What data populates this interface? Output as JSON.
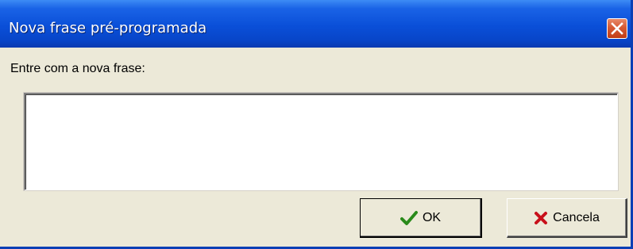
{
  "window": {
    "title": "Nova frase pré-programada",
    "close_icon": "close-icon",
    "colors": {
      "titlebar": "#0a4fd8",
      "body": "#ece9d8",
      "close_button": "#d65a34"
    }
  },
  "form": {
    "prompt_label": "Entre com a nova frase:",
    "phrase_value": ""
  },
  "buttons": {
    "ok": {
      "label": "OK",
      "icon": "checkmark-icon",
      "icon_color": "#2a8a1a"
    },
    "cancel": {
      "label": "Cancela",
      "icon": "x-mark-icon",
      "icon_color": "#c8101a"
    }
  }
}
